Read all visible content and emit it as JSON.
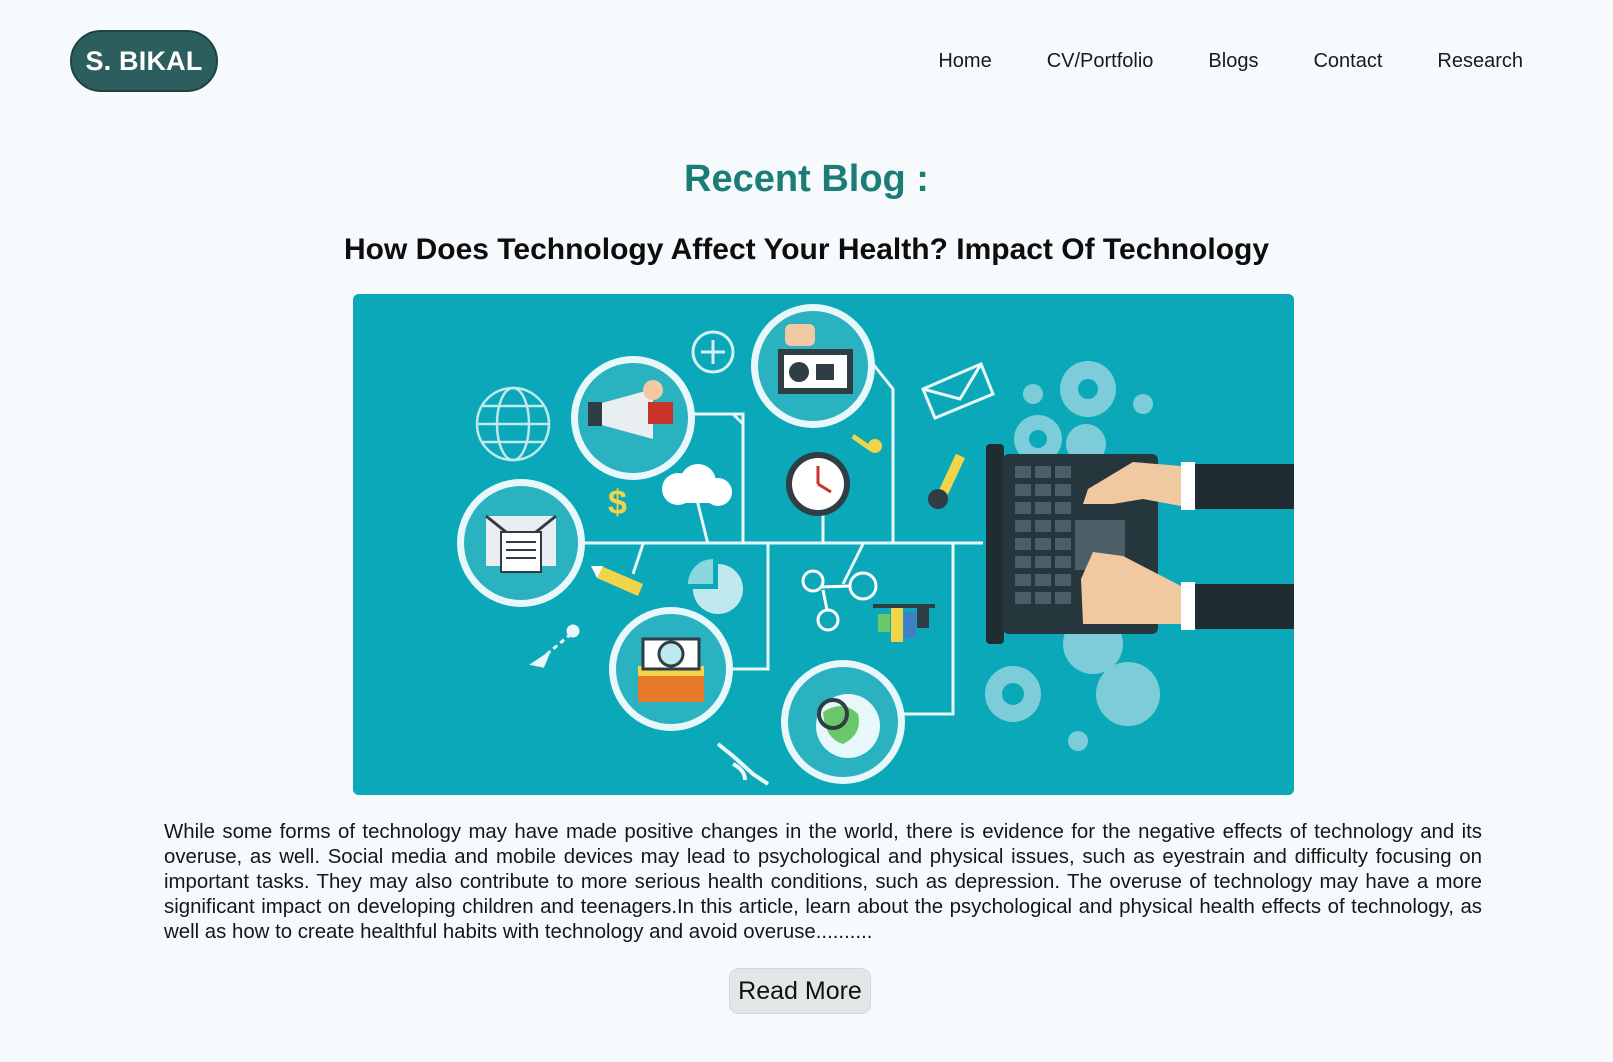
{
  "header": {
    "logo_text": "S. BIKAL",
    "nav": [
      "Home",
      "CV/Portfolio",
      "Blogs",
      "Contact",
      "Research"
    ]
  },
  "main": {
    "section_title": "Recent Blog :",
    "post": {
      "title": "How Does Technology Affect Your Health? Impact Of Technology",
      "image_alt": "technology-network-illustration",
      "excerpt": "While some forms of technology may have made positive changes in the world, there is evidence for the negative effects of technology and its overuse, as well. Social media and mobile devices may lead to psychological and physical issues, such as eyestrain and difficulty focusing on important tasks. They may also contribute to more serious health conditions, such as depression. The overuse of technology may have a more significant impact on developing children and teenagers.In this article, learn about the psychological and physical health effects of technology, as well as how to create healthful habits with technology and avoid overuse..........",
      "read_more_label": "Read More"
    }
  },
  "colors": {
    "accent": "#1a7d78",
    "logo_bg": "#2b5e5c",
    "hero_bg": "#0aa8b8",
    "page_bg": "#f6fafc"
  }
}
